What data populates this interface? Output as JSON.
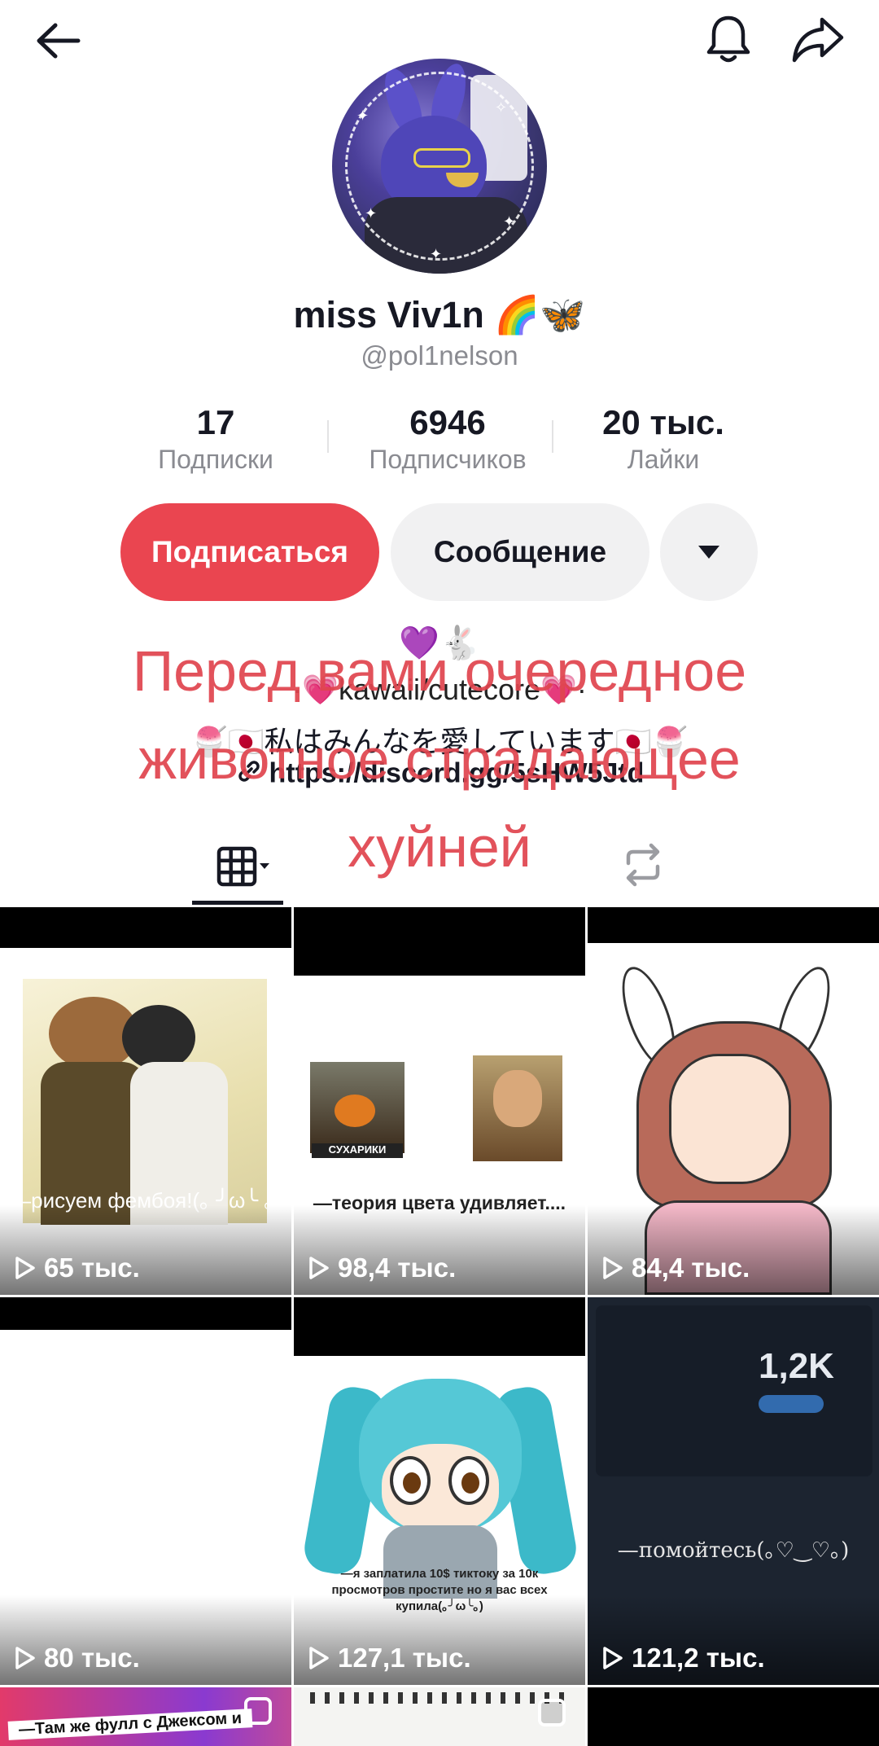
{
  "header": {
    "back_icon": "arrow-left-icon",
    "bell_icon": "bell-icon",
    "share_icon": "share-arrow-icon"
  },
  "profile": {
    "display_name": "miss Viv1n 🌈🦋",
    "username": "@pol1nelson"
  },
  "stats": [
    {
      "value": "17",
      "label": "Подписки"
    },
    {
      "value": "6946",
      "label": "Подписчиков"
    },
    {
      "value": "20 тыс.",
      "label": "Лайки"
    }
  ],
  "actions": {
    "follow": "Подписаться",
    "message": "Сообщение",
    "more_icon": "caret-down-icon"
  },
  "bio": {
    "line1": "💜🐇",
    "line2": "·💗kawaii/cutecore💗·",
    "line3": "🍧🇯🇵私はみんなを愛しています🇯🇵🍧",
    "link": "https://discord.gg/5sHW5Jtd"
  },
  "overlay_text": [
    "Перед вами очередное",
    "животное страдающее",
    "хуйней"
  ],
  "tabs": {
    "grid_icon": "grid-icon",
    "repost_icon": "repost-icon"
  },
  "videos": [
    {
      "views": "65 тыс.",
      "caption": "—рисуем фембоя!(｡ ╯ω╰ ｡)"
    },
    {
      "views": "98,4 тыс.",
      "caption": "—теория цвета удивляет....",
      "label_small": "СУХАРИКИ"
    },
    {
      "views": "84,4 тыс.",
      "caption": ""
    },
    {
      "views": "80 тыс.",
      "caption": ""
    },
    {
      "views": "127,1 тыс.",
      "caption": "—я заплатила 10$ тиктоку за 10к просмотров простите но я вас всех купила(｡╯ω╰｡)"
    },
    {
      "views": "121,2 тыс.",
      "caption": "—помойтесь(｡♡‿♡｡)",
      "overlay_num": "1,2K"
    },
    {
      "views": "",
      "caption": "—Там же фулл с Джексом и"
    },
    {
      "views": "",
      "caption": ""
    },
    {
      "views": "",
      "caption": ""
    }
  ],
  "colors": {
    "accent": "#ea4550",
    "overlay": "#e0454f"
  }
}
